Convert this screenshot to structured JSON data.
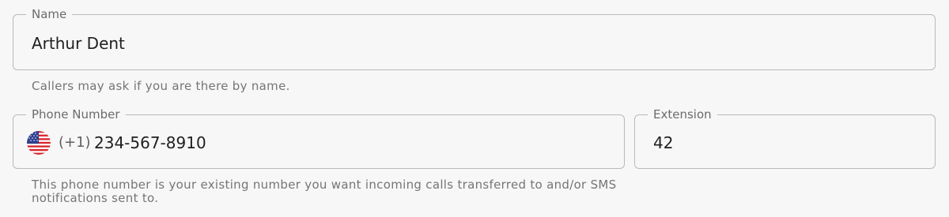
{
  "name_field": {
    "label": "Name",
    "value": "Arthur Dent",
    "helper": "Callers may ask if you are there by name."
  },
  "phone_field": {
    "label": "Phone Number",
    "country_flag_icon": "us-flag-icon",
    "country_code": "(+1)",
    "value": "234-567-8910",
    "helper": "This phone number is your existing number you want incoming calls transferred to and/or SMS notifications sent to."
  },
  "extension_field": {
    "label": "Extension",
    "value": "42"
  },
  "colors": {
    "background": "#f7f7f7",
    "border": "#b9b9b9",
    "label": "#6b6b6b",
    "helper": "#757575",
    "flag_red": "#d8232a",
    "flag_blue": "#2c3f8f"
  }
}
